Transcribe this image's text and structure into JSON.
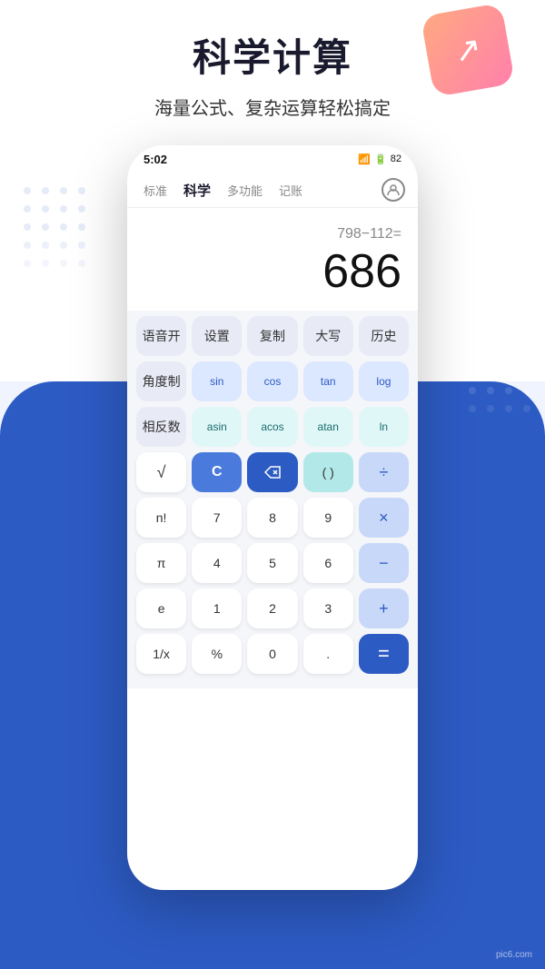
{
  "header": {
    "title": "科学计算",
    "subtitle": "海量公式、复杂运算轻松搞定"
  },
  "deco": {
    "icon": "↗"
  },
  "phone": {
    "status": {
      "time": "5:02",
      "wifi": "WiFi",
      "battery": "82"
    },
    "nav": {
      "tabs": [
        "标准",
        "科学",
        "多功能",
        "记账"
      ],
      "active_index": 1
    },
    "display": {
      "expression": "798−112=",
      "result": "686"
    },
    "buttons": {
      "row1": [
        "语音开",
        "设置",
        "复制",
        "大写",
        "历史"
      ],
      "row2": [
        "角度制",
        "sin",
        "cos",
        "tan",
        "log"
      ],
      "row3": [
        "相反数",
        "asin",
        "acos",
        "atan",
        "ln"
      ],
      "row4": [
        "√",
        "C",
        "⌫",
        "( )",
        "÷"
      ],
      "row5": [
        "n!",
        "7",
        "8",
        "9",
        "×"
      ],
      "row6": [
        "π",
        "4",
        "5",
        "6",
        "−"
      ],
      "row7": [
        "e",
        "1",
        "2",
        "3",
        "+"
      ],
      "row8": [
        "1/x",
        "%",
        "0",
        ".",
        "="
      ]
    }
  },
  "watermark": "pic6.com"
}
